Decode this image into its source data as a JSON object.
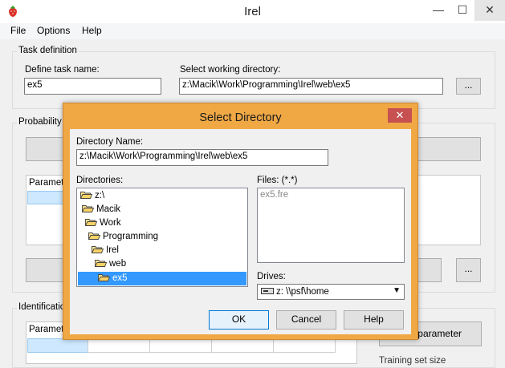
{
  "window": {
    "title": "Irel",
    "minimize": "—",
    "maximize": "☐",
    "close": "✕"
  },
  "menu": [
    "File",
    "Options",
    "Help"
  ],
  "task": {
    "group_label": "Task definition",
    "name_label": "Define task name:",
    "name_value": "ex5",
    "dir_label": "Select working directory:",
    "dir_value": "z:\\Macik\\Work\\Programming\\Irel\\web\\ex5",
    "browse_label": "..."
  },
  "probability": {
    "group_label": "Probability ta",
    "param_header": "Paramete",
    "browse_label": "..."
  },
  "identification": {
    "group_label": "Identification",
    "param_header": "Paramete",
    "param_button": "te parameter",
    "training_label": "Training set size"
  },
  "dialog": {
    "title": "Select Directory",
    "close": "✕",
    "dir_name_label": "Directory Name:",
    "dir_name_value": "z:\\Macik\\Work\\Programming\\Irel\\web\\ex5",
    "directories_label": "Directories:",
    "tree": [
      "z:\\",
      "Macik",
      "Work",
      "Programming",
      "Irel",
      "web",
      "ex5"
    ],
    "files_label": "Files: (*.*)",
    "files": [
      "ex5.fre"
    ],
    "drives_label": "Drives:",
    "drive_value": "z:  \\\\psf\\home",
    "ok": "OK",
    "cancel": "Cancel",
    "help": "Help"
  },
  "colors": {
    "dialog_frame": "#f0a845",
    "selection": "#3399ff",
    "close_red": "#c75050"
  }
}
